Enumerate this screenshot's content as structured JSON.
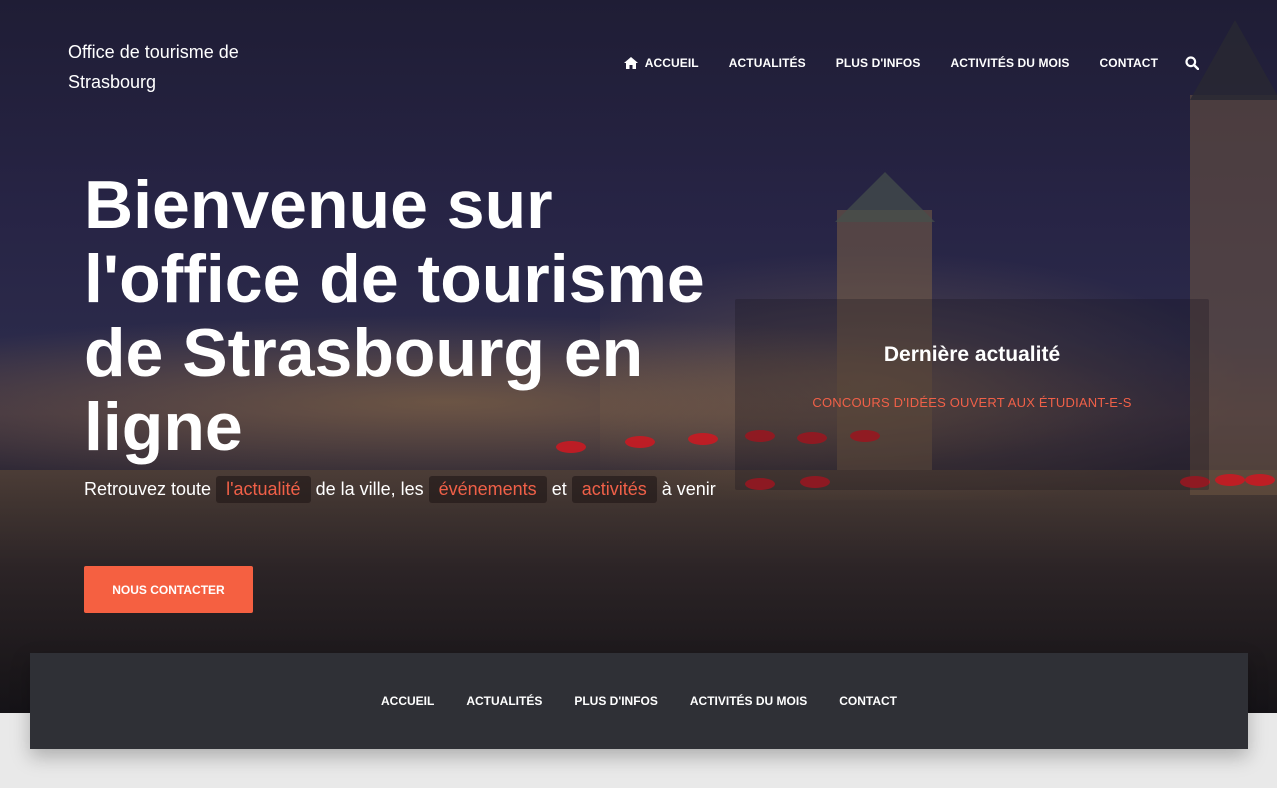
{
  "header": {
    "brand": "Office de tourisme de Strasbourg",
    "nav": [
      {
        "label": "ACCUEIL",
        "icon": "home-icon"
      },
      {
        "label": "ACTUALITÉS"
      },
      {
        "label": "PLUS D'INFOS"
      },
      {
        "label": "ACTIVITÉS DU MOIS"
      },
      {
        "label": "CONTACT"
      }
    ],
    "search_icon": "search-icon"
  },
  "hero": {
    "headline": "Bienvenue sur l'office de tourisme de Strasbourg en ligne",
    "tagline": {
      "part1": "Retrouvez toute",
      "highlight1": "l'actualité",
      "part2": "de la ville, les",
      "highlight2": "événements",
      "part3": "et",
      "highlight3": "activités",
      "part4": "à venir"
    },
    "cta_label": "NOUS CONTACTER"
  },
  "latest_news": {
    "title": "Dernière actualité",
    "link": "CONCOURS D'IDÉES OUVERT AUX ÉTUDIANT-E-S"
  },
  "footer_nav": [
    "ACCUEIL",
    "ACTUALITÉS",
    "PLUS D'INFOS",
    "ACTIVITÉS DU MOIS",
    "CONTACT"
  ],
  "colors": {
    "accent": "#f56041",
    "footer_bg": "#2f3036",
    "page_bg": "#e9e9e9"
  }
}
